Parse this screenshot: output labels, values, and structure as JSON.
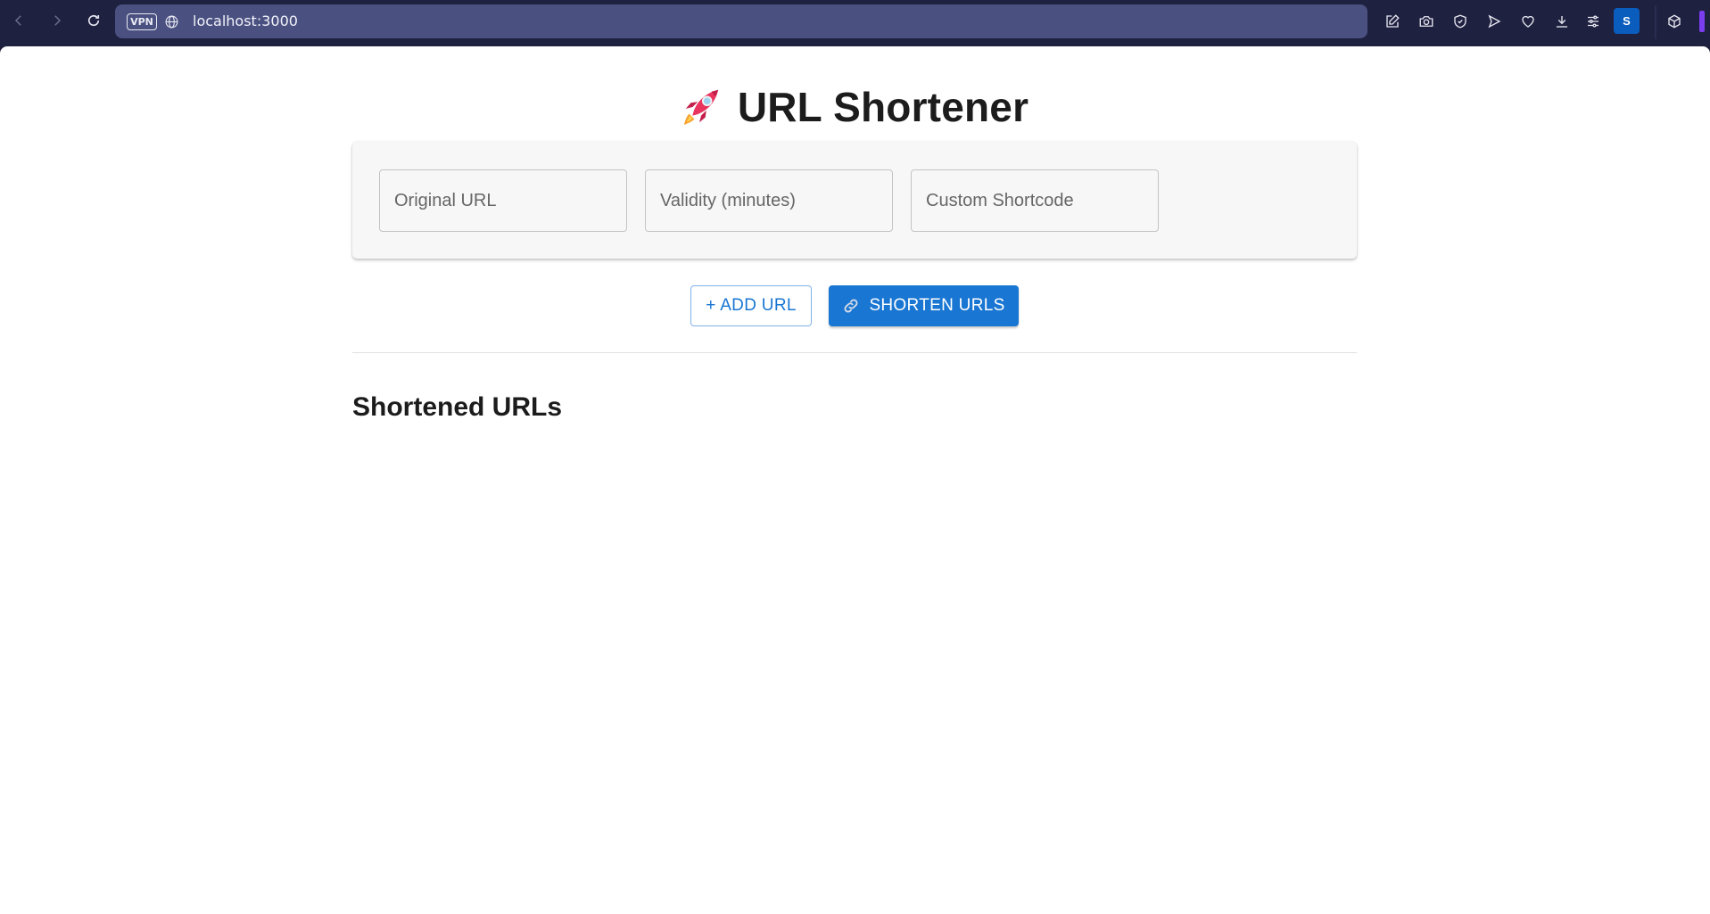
{
  "browser": {
    "url": "localhost:3000",
    "vpn_label": "VPN",
    "profile_initial": "S"
  },
  "page": {
    "title": "URL Shortener",
    "form": {
      "original_url_placeholder": "Original URL",
      "validity_placeholder": "Validity (minutes)",
      "shortcode_placeholder": "Custom Shortcode"
    },
    "buttons": {
      "add_url": "+ ADD URL",
      "shorten_urls": "SHORTEN URLS"
    },
    "section_title": "Shortened URLs"
  },
  "colors": {
    "primary": "#1976d2",
    "chrome_bg": "#1f2140",
    "address_bar": "#4a5080",
    "profile_badge": "#0a5dbd"
  }
}
